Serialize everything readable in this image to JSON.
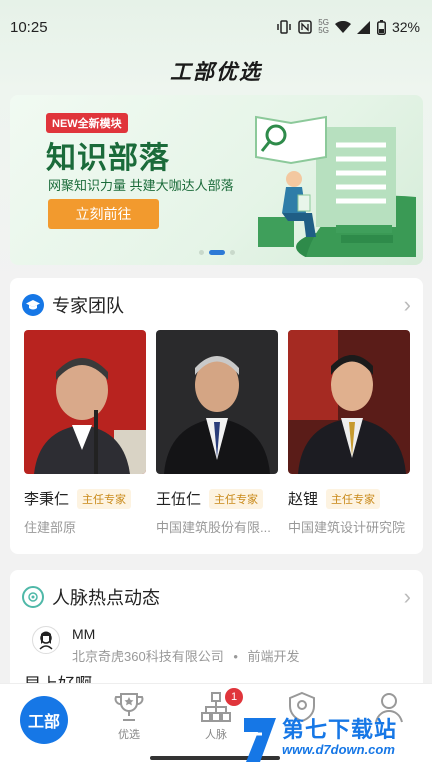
{
  "status": {
    "time": "10:25",
    "battery": "32%"
  },
  "app": {
    "title": "工部优选"
  },
  "banner": {
    "tag": "NEW全新模块",
    "title": "知识部落",
    "subtitle": "网聚知识力量 共建大咖达人部落",
    "button": "立刻前往"
  },
  "experts": {
    "title": "专家团队",
    "items": [
      {
        "name": "李秉仁",
        "badge": "主任专家",
        "org": "住建部原"
      },
      {
        "name": "王伍仁",
        "badge": "主任专家",
        "org": "中国建筑股份有限..."
      },
      {
        "name": "赵锂",
        "badge": "主任专家",
        "org": "中国建筑设计研究院"
      }
    ]
  },
  "network": {
    "title": "人脉热点动态",
    "person": {
      "name": "MM",
      "company": "北京奇虎360科技有限公司",
      "sep": "•",
      "role": "前端开发"
    },
    "post_text": "早上好啊"
  },
  "tabbar": {
    "home": "工部",
    "tabs": [
      {
        "label": "优选",
        "icon": "trophy-icon"
      },
      {
        "label": "人脉",
        "icon": "network-icon",
        "badge": "1"
      },
      {
        "label": "",
        "icon": "shield-icon"
      },
      {
        "label": "",
        "icon": "user-icon"
      }
    ]
  },
  "watermark": {
    "title": "第七下载站",
    "url": "www.d7down.com"
  },
  "colors": {
    "primary": "#1677e6",
    "banner_green": "#1b6b3a",
    "button_orange": "#f29a2e",
    "badge_red": "#e0353b"
  }
}
